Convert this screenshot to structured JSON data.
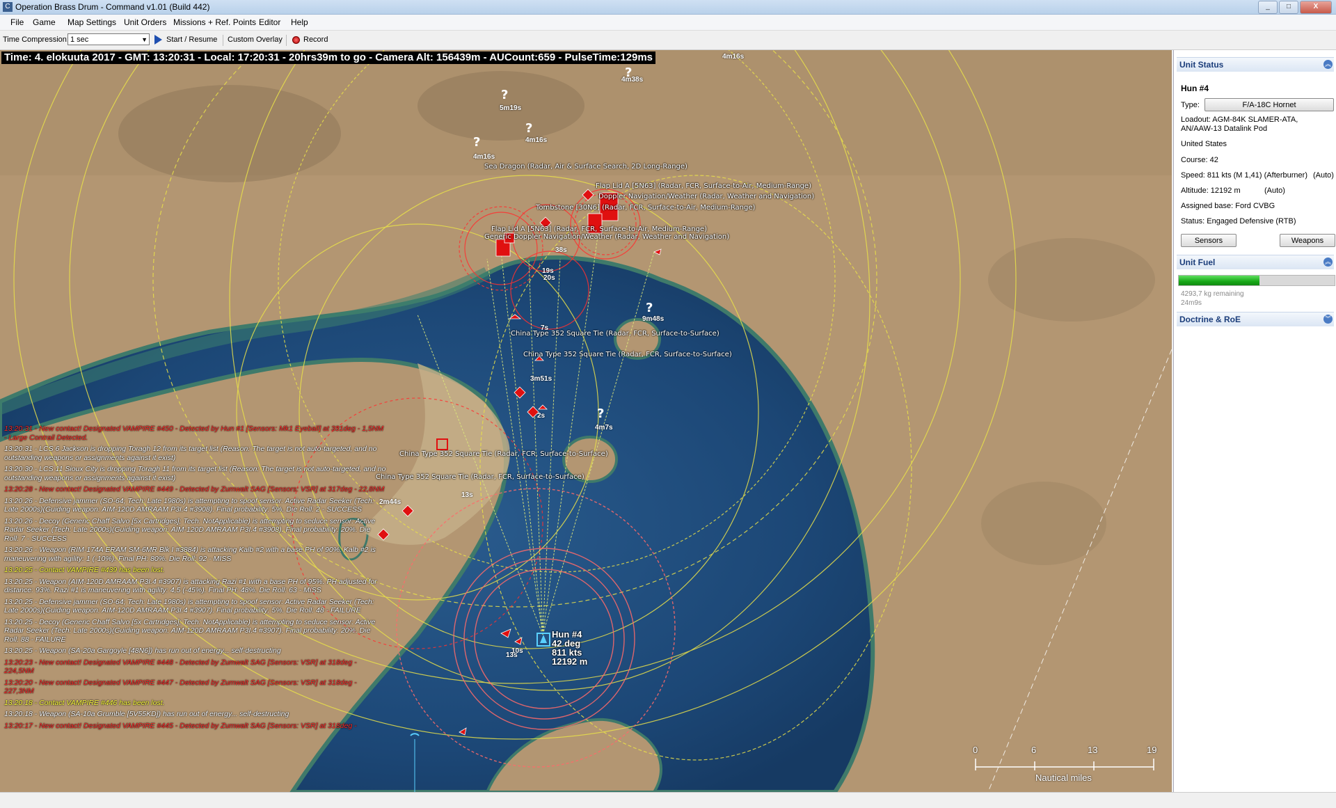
{
  "window": {
    "title": "Operation Brass Drum - Command v1.01 (Build 442)",
    "controls": [
      "_",
      "□",
      "X"
    ]
  },
  "menu": [
    "File",
    "Game",
    "Map Settings",
    "Unit Orders",
    "Missions + Ref. Points",
    "Editor",
    "Help"
  ],
  "toolbar": {
    "time_compression_label": "Time Compression:",
    "time_compression_value": "1 sec",
    "start_resume": "Start / Resume",
    "custom_overlay": "Custom Overlay",
    "record": "Record"
  },
  "status_line": "Time: 4. elokuuta 2017 - GMT: 13:20:31 - Local: 17:20:31 - 20hrs39m to go -  Camera Alt: 156439m - AUCount:659 - PulseTime:129ms",
  "message_log": [
    {
      "text": "13:20:31 - New contact! Designated VAMPIRE #450 - Detected by Hun #1 [Sensors: Mk1 Eyeball] at 331deg - 1,5NM - Large Contrail Detected.",
      "color": "red"
    },
    {
      "text": "13:20:31 - LCS 6 Jackson is dropping Toragh 12 from its target list (Reason: The target is not auto-targeted, and no outstanding weapons or assignments against it exist)",
      "color": "white"
    },
    {
      "text": "13:20:30 - LCS 11 Sioux City is dropping Toragh 11 from its target list (Reason: The target is not auto-targeted, and no outstanding weapons or assignments against it exist)",
      "color": "white"
    },
    {
      "text": "13:20:28 - New contact! Designated VAMPIRE #449 - Detected by Zumwalt SAG [Sensors: VSR] at 317deg - 22,8NM",
      "color": "red"
    },
    {
      "text": "13:20:26 - Defensive jammer (SO-64; Tech: Late 1980s) is attempting to spoof sensor: Active Radar Seeker (Tech: Late 2000s)(Guiding weapon: AIM-120D AMRAAM P3I.4 #3908). Final probability: 5%. Die Roll: 2 - SUCCESS",
      "color": "white"
    },
    {
      "text": "13:20:26 - Decoy (Generic Chaff Salvo [5x Cartridges]; Tech: NotApplicable) is attempting to seduce sensor: Active Radar Seeker (Tech: Late 2000s)(Guiding weapon: AIM-120D AMRAAM P3I.4 #3908). Final probability: 20%. Die Roll: 7 - SUCCESS",
      "color": "white"
    },
    {
      "text": "13:20:26 - Weapon (RIM-174A ERAM SM-6MR Blk I #3884) is attacking Kalb #2 with a base PH of 90%. Kalb #2 is maneuvering with agility: 1 (-10%). Final PH: 80%. Die Roll: 92 - MISS",
      "color": "white"
    },
    {
      "text": "13:20:25 - Contact VAMPIRE #439 has been lost.",
      "color": "yellow"
    },
    {
      "text": "13:20:25 - Weapon (AIM-120D AMRAAM P3I.4 #3907) is attacking Razi #1 with a base PH of 95%. PH adjusted for distance: 93%. Razi #1 is maneuvering with agility: 4,5 (-45%). Final PH: 48%. Die Roll: 63 - MISS",
      "color": "white"
    },
    {
      "text": "13:20:25 - Defensive jammer (SO-64; Tech: Late 1980s) is attempting to spoof sensor: Active Radar Seeker (Tech: Late 2000s)(Guiding weapon: AIM-120D AMRAAM P3I.4 #3907). Final probability: 5%. Die Roll: 48 - FAILURE",
      "color": "white"
    },
    {
      "text": "13:20:25 - Decoy (Generic Chaff Salvo [5x Cartridges]; Tech: NotApplicable) is attempting to seduce sensor: Active Radar Seeker (Tech: Late 2000s)(Guiding weapon: AIM-120D AMRAAM P3I.4 #3907). Final probability: 20%. Die Roll: 88 - FAILURE",
      "color": "white"
    },
    {
      "text": "13:20:25 - Weapon (SA-20a Gargoyle [48N6]) has run out of energy... self-destructing",
      "color": "white"
    },
    {
      "text": "13:20:23 - New contact! Designated VAMPIRE #448 - Detected by Zumwalt SAG [Sensors: VSR] at 318deg - 224,5NM",
      "color": "red"
    },
    {
      "text": "13:20:20 - New contact! Designated VAMPIRE #447 - Detected by Zumwalt SAG [Sensors: VSR] at 318deg - 227,3NM",
      "color": "red"
    },
    {
      "text": "13:20:18 - Contact VAMPIRE #446 has been lost.",
      "color": "yellow"
    },
    {
      "text": "13:20:18 - Weapon (SA-10a Grumble [5V55KD]) has run out of energy... self-destructing",
      "color": "white"
    },
    {
      "text": "13:20:17 - New contact! Designated VAMPIRE #445 - Detected by Zumwalt SAG [Sensors: VSR] at 318deg -",
      "color": "red"
    }
  ],
  "map_labels": {
    "sea_dragon": "Sea Dragon (Radar, Air & Surface Search, 2D Long-Range)",
    "flap_lid_1": "Flap Lid A [5N63] (Radar, FCR, Surface-to-Air, Medium-Range)",
    "doppler_1": "Doppler Navigation/Weather (Radar, Weather and Navigation)",
    "tombstone": "Tombstone [30N6] (Radar, FCR, Surface-to-Air, Medium-Range)",
    "flap_lid_2": "Flap Lid A [5N63] (Radar, FCR, Surface-to-Air, Medium-Range)",
    "doppler_2": "Generic Doppler Navigation/Weather (Radar, Weather and Navigation)",
    "china_1": "China Type 352 Square Tie (Radar, FCR, Surface-to-Surface)",
    "china_2": "China Type 352 Square Tie (Radar, FCR, Surface-to-Surface)",
    "china_3": "China Type 352 Square Tie (Radar, FCR, Surface-to-Surface)",
    "china_4": "China Type 352 Square Tie (Radar, FCR, Surface-to-Surface)"
  },
  "time_labels": [
    "4m16s",
    "4m38s",
    "5m19s",
    "4m16s",
    "4m16s",
    "38s",
    "19s",
    "20s",
    "7s",
    "3m51s",
    "2s",
    "9m48s",
    "4m7s",
    "13s",
    "2m44s",
    "10s",
    "13s"
  ],
  "selected_unit_tag": {
    "name": "Hun #4",
    "course": "42 deg",
    "speed": "811 kts",
    "altitude": "12192 m"
  },
  "scale": {
    "ticks": [
      "0",
      "6",
      "13",
      "19"
    ],
    "unit": "Nautical miles"
  },
  "unit_status": {
    "header": "Unit Status",
    "name": "Hun #4",
    "type_label": "Type:",
    "type_value": "F/A-18C Hornet",
    "loadout": "Loadout: AGM-84K SLAMER-ATA, AN/AAW-13 Datalink Pod",
    "country": "United States",
    "course": "Course: 42",
    "speed": "Speed: 811 kts (M 1,41) (Afterburner)",
    "speed_mode": "(Auto)",
    "altitude": "Altitude: 12192 m",
    "altitude_mode": "(Auto)",
    "base": "Assigned base: Ford CVBG",
    "status": "Status: Engaged Defensive (RTB)",
    "sensors_button": "Sensors",
    "weapons_button": "Weapons"
  },
  "unit_fuel": {
    "header": "Unit Fuel",
    "fraction": 0.52,
    "remaining": "4293,7 kg remaining",
    "time": "24m9s"
  },
  "doctrine": {
    "header": "Doctrine & RoE"
  },
  "colors": {
    "sea": "#1d4a7a",
    "land": "#b7996f",
    "range_ring": "#e8e04a",
    "hostile": "#e01010",
    "friendly": "#5ad0ff",
    "fuel_green": "#18a818"
  }
}
